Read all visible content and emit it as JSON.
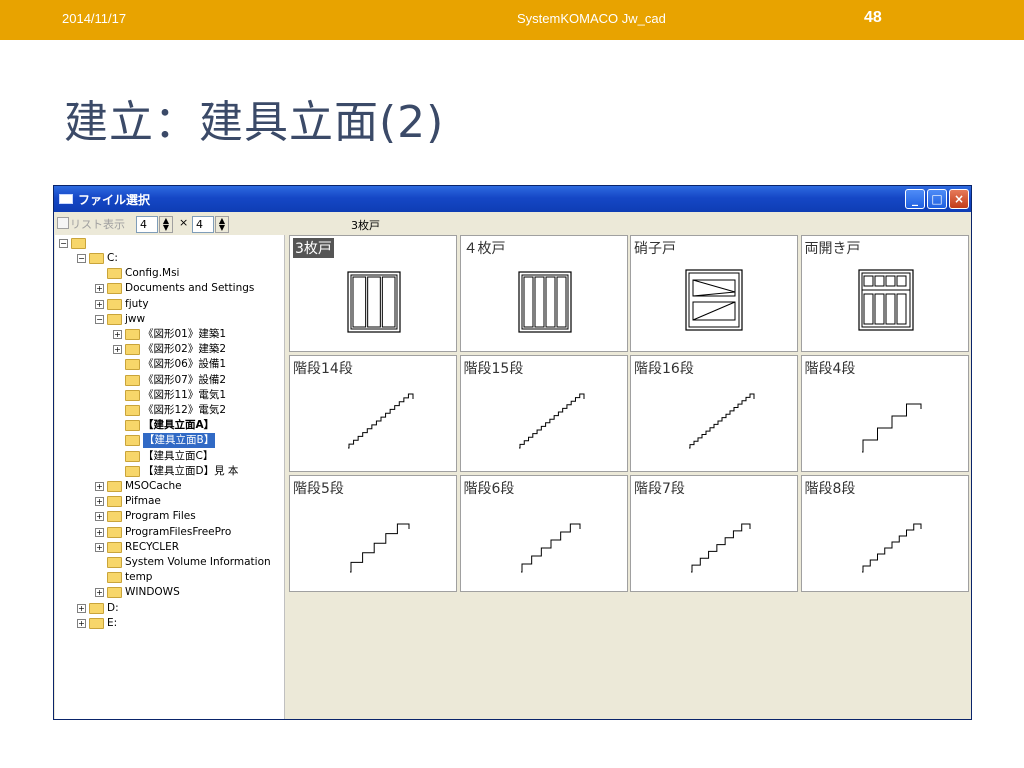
{
  "slide": {
    "date": "2014/11/17",
    "footer_center": "SystemKOMACO Jw_cad",
    "page_number": "48",
    "title": "建立：建具立面(2)"
  },
  "window": {
    "title": "ファイル選択",
    "list_toggle_label": "リスト表示",
    "cols_value": "4",
    "rows_value": "4",
    "times_sign": "×",
    "current_file": "3枚戸"
  },
  "tree": [
    {
      "label": "C:",
      "indent": 1,
      "expander": "−"
    },
    {
      "label": "Config.Msi",
      "indent": 2,
      "expander": ""
    },
    {
      "label": "Documents and Settings",
      "indent": 2,
      "expander": "+"
    },
    {
      "label": "fjuty",
      "indent": 2,
      "expander": "+"
    },
    {
      "label": "jww",
      "indent": 2,
      "expander": "−"
    },
    {
      "label": "《図形01》建築1",
      "indent": 3,
      "expander": "+"
    },
    {
      "label": "《図形02》建築2",
      "indent": 3,
      "expander": "+"
    },
    {
      "label": "《図形06》設備1",
      "indent": 3,
      "expander": ""
    },
    {
      "label": "《図形07》設備2",
      "indent": 3,
      "expander": ""
    },
    {
      "label": "《図形11》電気1",
      "indent": 3,
      "expander": ""
    },
    {
      "label": "《図形12》電気2",
      "indent": 3,
      "expander": ""
    },
    {
      "label": "【建具立面A】",
      "indent": 3,
      "expander": "",
      "bold": true
    },
    {
      "label": "【建具立面B】",
      "indent": 3,
      "expander": "",
      "selected": true
    },
    {
      "label": "【建具立面C】",
      "indent": 3,
      "expander": ""
    },
    {
      "label": "【建具立面D】見 本",
      "indent": 3,
      "expander": ""
    },
    {
      "label": "MSOCache",
      "indent": 2,
      "expander": "+"
    },
    {
      "label": "Pifmae",
      "indent": 2,
      "expander": "+"
    },
    {
      "label": "Program Files",
      "indent": 2,
      "expander": "+"
    },
    {
      "label": "ProgramFilesFreePro",
      "indent": 2,
      "expander": "+"
    },
    {
      "label": "RECYCLER",
      "indent": 2,
      "expander": "+"
    },
    {
      "label": "System Volume Information",
      "indent": 2,
      "expander": ""
    },
    {
      "label": "temp",
      "indent": 2,
      "expander": ""
    },
    {
      "label": "WINDOWS",
      "indent": 2,
      "expander": "+"
    },
    {
      "label": "D:",
      "indent": 1,
      "expander": "+"
    },
    {
      "label": "E:",
      "indent": 1,
      "expander": "+"
    }
  ],
  "thumbnails": [
    {
      "label": "3枚戸",
      "kind": "door3",
      "selected": true
    },
    {
      "label": "４枚戸",
      "kind": "door4"
    },
    {
      "label": "硝子戸",
      "kind": "glass"
    },
    {
      "label": "両開き戸",
      "kind": "double"
    },
    {
      "label": "階段14段",
      "kind": "stair",
      "steps": 14
    },
    {
      "label": "階段15段",
      "kind": "stair",
      "steps": 15
    },
    {
      "label": "階段16段",
      "kind": "stair",
      "steps": 16
    },
    {
      "label": "階段4段",
      "kind": "stair",
      "steps": 4
    },
    {
      "label": "階段5段",
      "kind": "stair",
      "steps": 5
    },
    {
      "label": "階段6段",
      "kind": "stair",
      "steps": 6
    },
    {
      "label": "階段7段",
      "kind": "stair",
      "steps": 7
    },
    {
      "label": "階段8段",
      "kind": "stair",
      "steps": 8
    }
  ],
  "colors": {
    "topbar": "#e8a300",
    "title": "#3b4a68",
    "titlebar": "#1547c6"
  }
}
